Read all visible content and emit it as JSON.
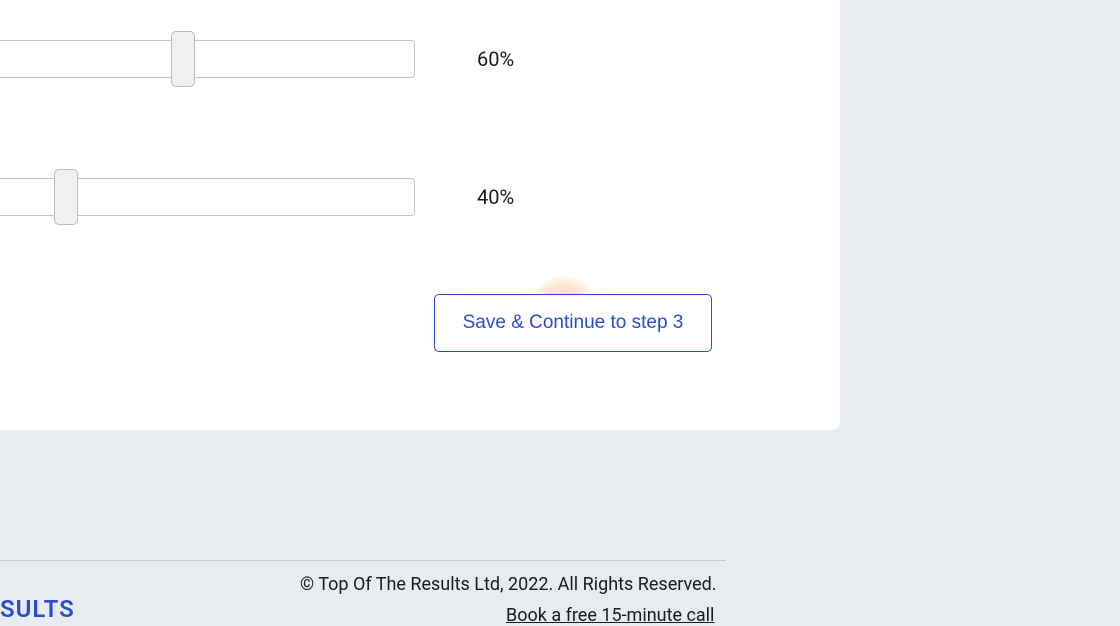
{
  "sliders": [
    {
      "value_label": "60%",
      "thumb_position_percent": 62
    },
    {
      "value_label": "40%",
      "thumb_position_percent": 42.8
    }
  ],
  "continue_button_label": "Save & Continue to step 3",
  "footer": {
    "copyright": "© Top Of The Results Ltd, 2022. All Rights Reserved.",
    "cta_link": "Book a free 15-minute call",
    "logo_fragment": "SULTS"
  }
}
